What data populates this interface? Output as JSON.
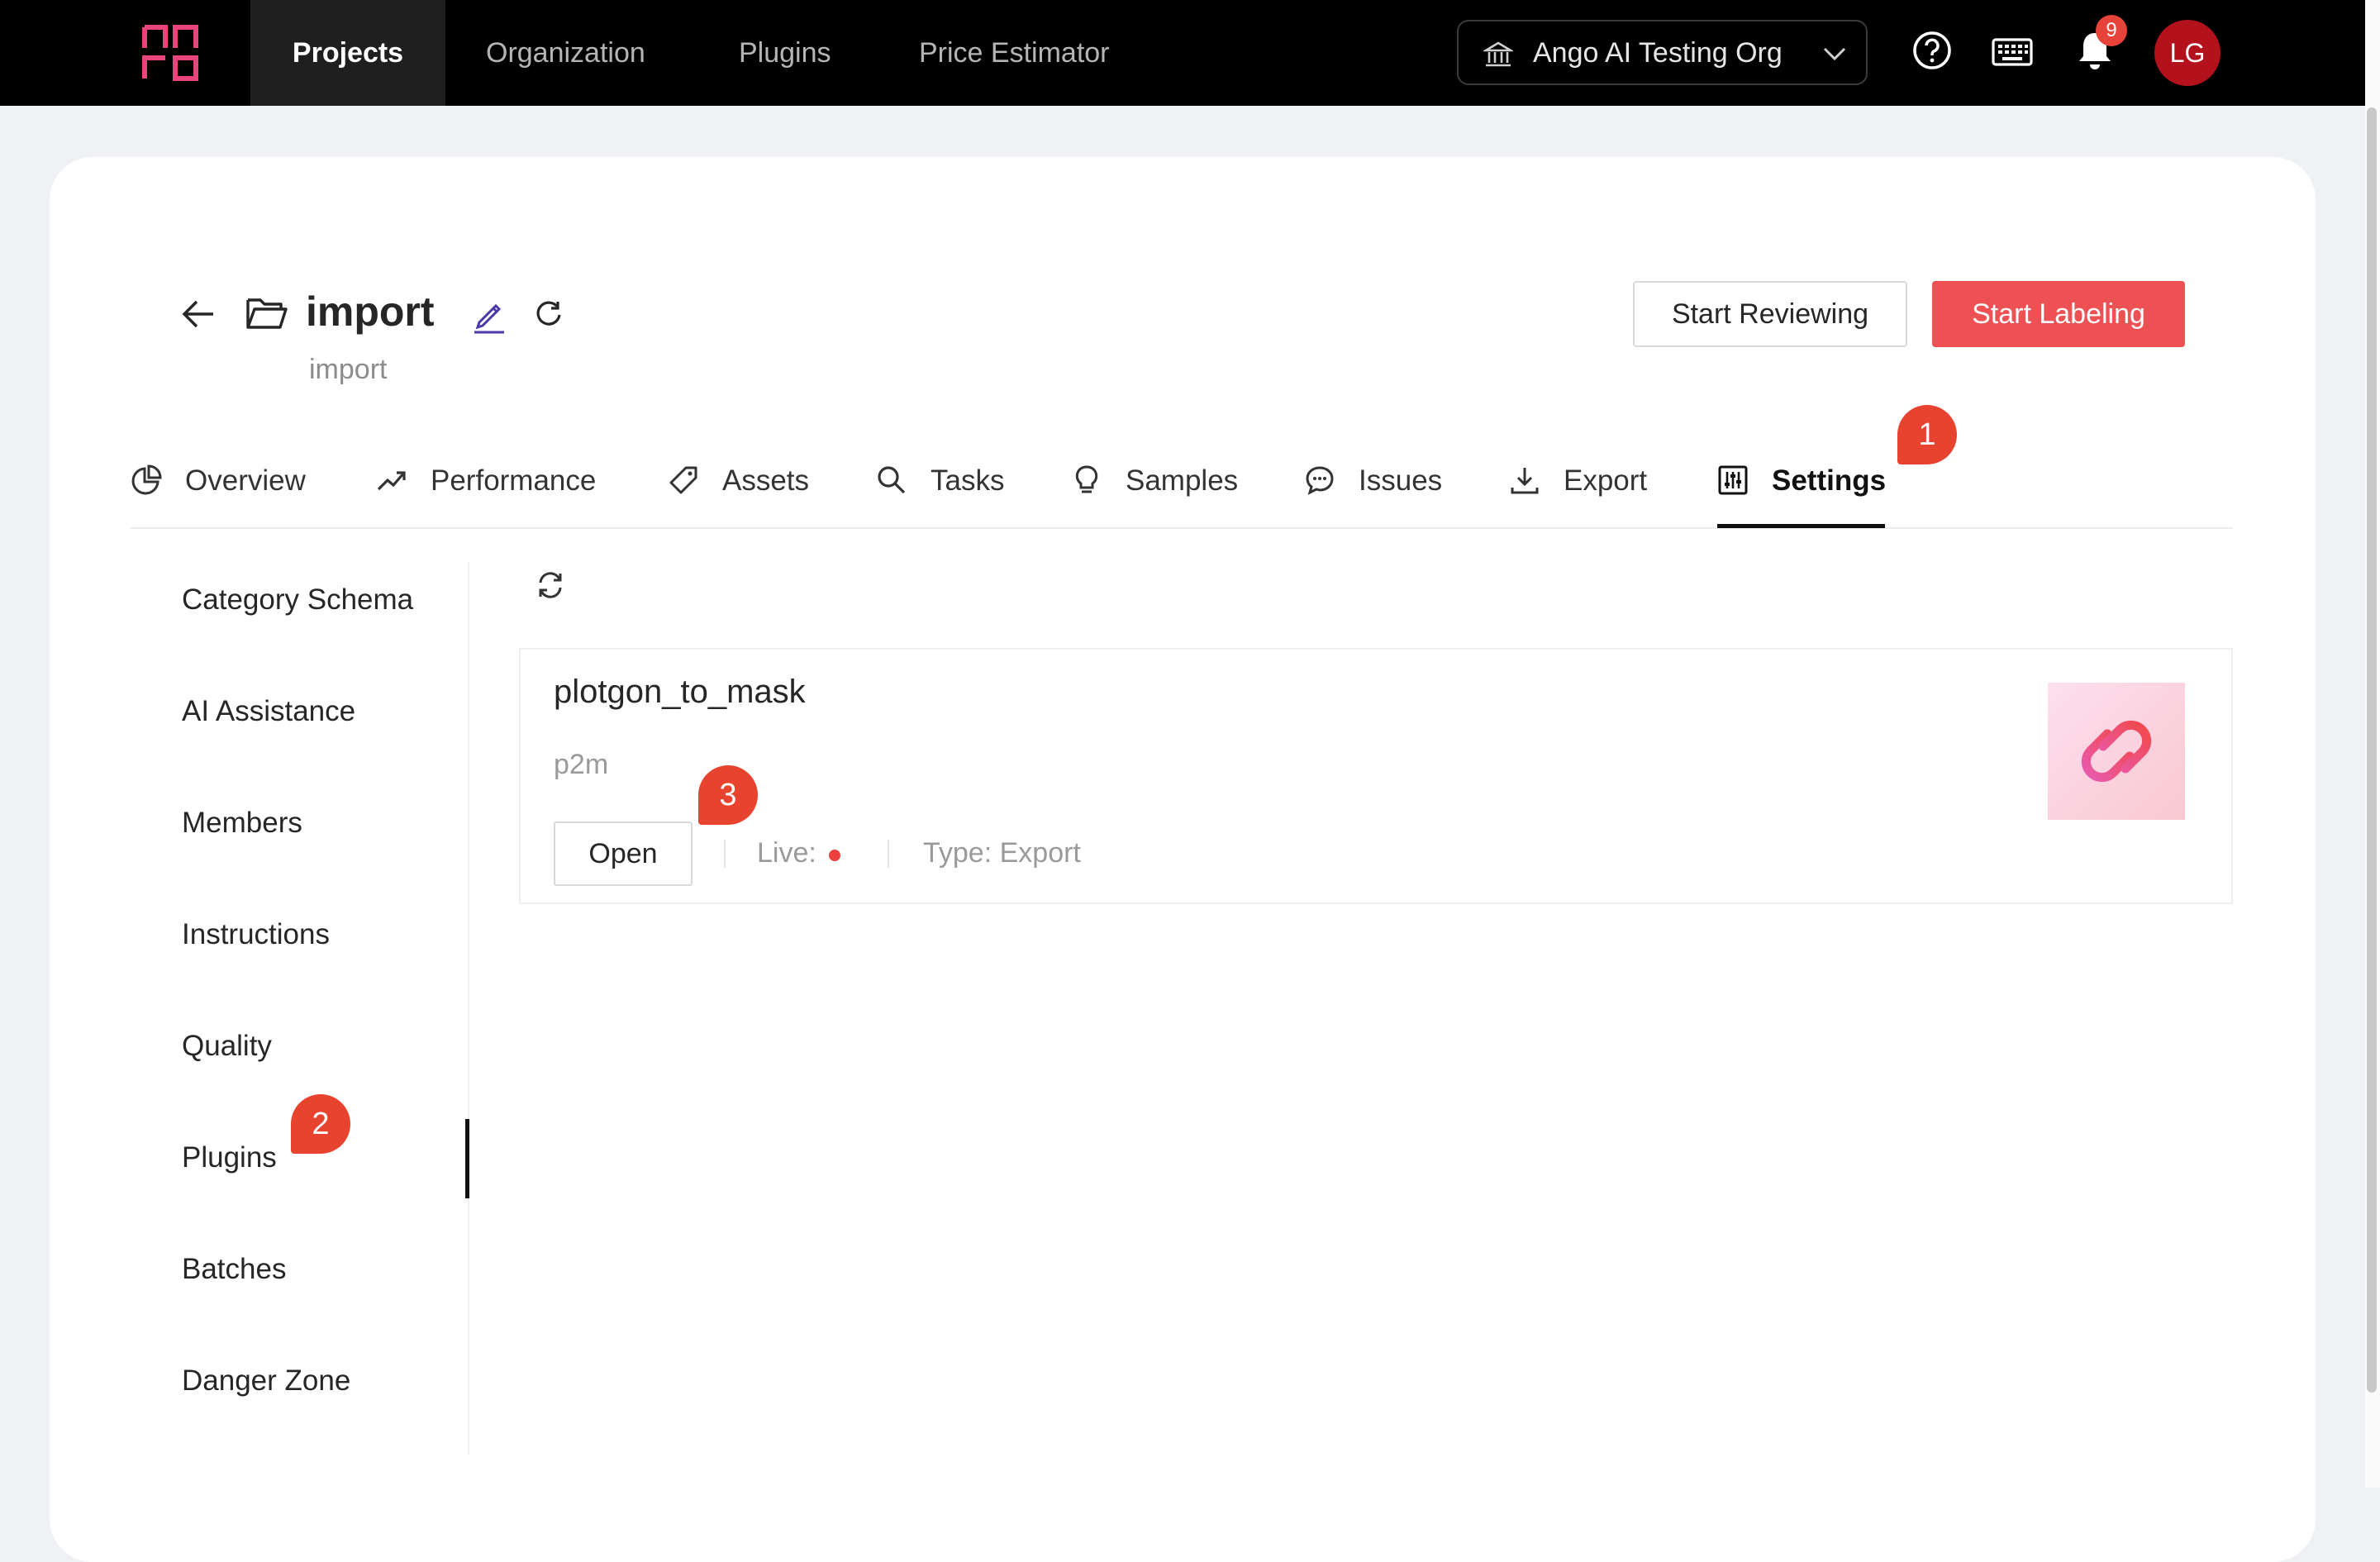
{
  "topnav": {
    "items": [
      {
        "label": "Projects",
        "active": true
      },
      {
        "label": "Organization"
      },
      {
        "label": "Plugins"
      },
      {
        "label": "Price Estimator"
      }
    ],
    "org_name": "Ango AI Testing Org",
    "notification_count": "9",
    "avatar_initials": "LG"
  },
  "project": {
    "title": "import",
    "subtitle": "import",
    "start_reviewing_label": "Start Reviewing",
    "start_labeling_label": "Start Labeling"
  },
  "tabs": [
    {
      "label": "Overview",
      "icon": "pie-chart-icon"
    },
    {
      "label": "Performance",
      "icon": "trend-line-icon"
    },
    {
      "label": "Assets",
      "icon": "tag-icon"
    },
    {
      "label": "Tasks",
      "icon": "search-icon"
    },
    {
      "label": "Samples",
      "icon": "lightbulb-icon"
    },
    {
      "label": "Issues",
      "icon": "chat-bubble-icon"
    },
    {
      "label": "Export",
      "icon": "download-icon"
    },
    {
      "label": "Settings",
      "icon": "sliders-icon",
      "active": true
    }
  ],
  "settings_menu": [
    {
      "label": "Category Schema"
    },
    {
      "label": "AI Assistance"
    },
    {
      "label": "Members"
    },
    {
      "label": "Instructions"
    },
    {
      "label": "Quality"
    },
    {
      "label": "Plugins",
      "active": true
    },
    {
      "label": "Batches"
    },
    {
      "label": "Danger Zone"
    }
  ],
  "plugin": {
    "name": "plotgon_to_mask",
    "description": "p2m",
    "open_label": "Open",
    "live_label": "Live:",
    "live_status_color": "#ee3f3f",
    "type_label": "Type: Export"
  },
  "annotations": {
    "step1": "1",
    "step2": "2",
    "step3": "3"
  },
  "colors": {
    "primary": "#ee5153",
    "annotation": "#e8432f",
    "brand": "#e8457c"
  }
}
